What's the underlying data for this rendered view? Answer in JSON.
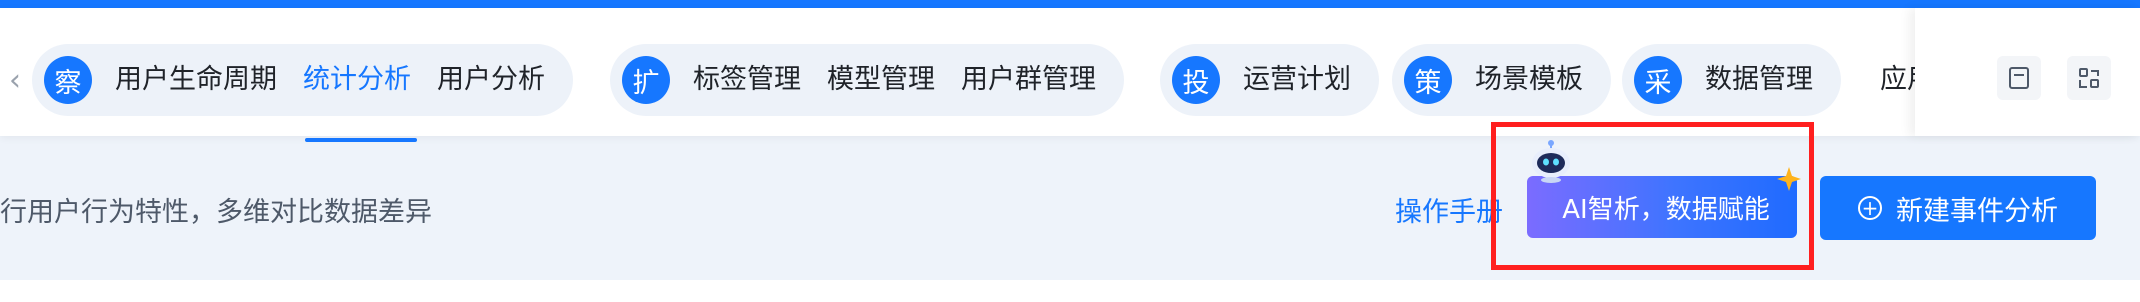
{
  "nav": {
    "groups": [
      {
        "badge": "察",
        "items": [
          "用户生命周期",
          "统计分析",
          "用户分析"
        ],
        "active_index": 1
      },
      {
        "badge": "扩",
        "items": [
          "标签管理",
          "模型管理",
          "用户群管理"
        ]
      },
      {
        "badge": "投",
        "items": [
          "运营计划"
        ]
      },
      {
        "badge": "策",
        "items": [
          "场景模板"
        ]
      },
      {
        "badge": "采",
        "items": [
          "数据管理"
        ]
      }
    ],
    "overflow_item": "应用",
    "left_arrow": "‹",
    "right_arrow": "›"
  },
  "toolbar": {
    "icons": [
      "document-icon",
      "layout-switch-icon"
    ]
  },
  "content": {
    "subtitle": "行用户行为特性，多维对比数据差异",
    "manual_link": "操作手册",
    "ai_button": "AI智析，数据赋能",
    "new_button": "新建事件分析",
    "new_button_icon": "⊕"
  },
  "colors": {
    "accent": "#1677ff",
    "highlight": "#ff1f1f",
    "ai_gradient_start": "#7b6cff"
  }
}
